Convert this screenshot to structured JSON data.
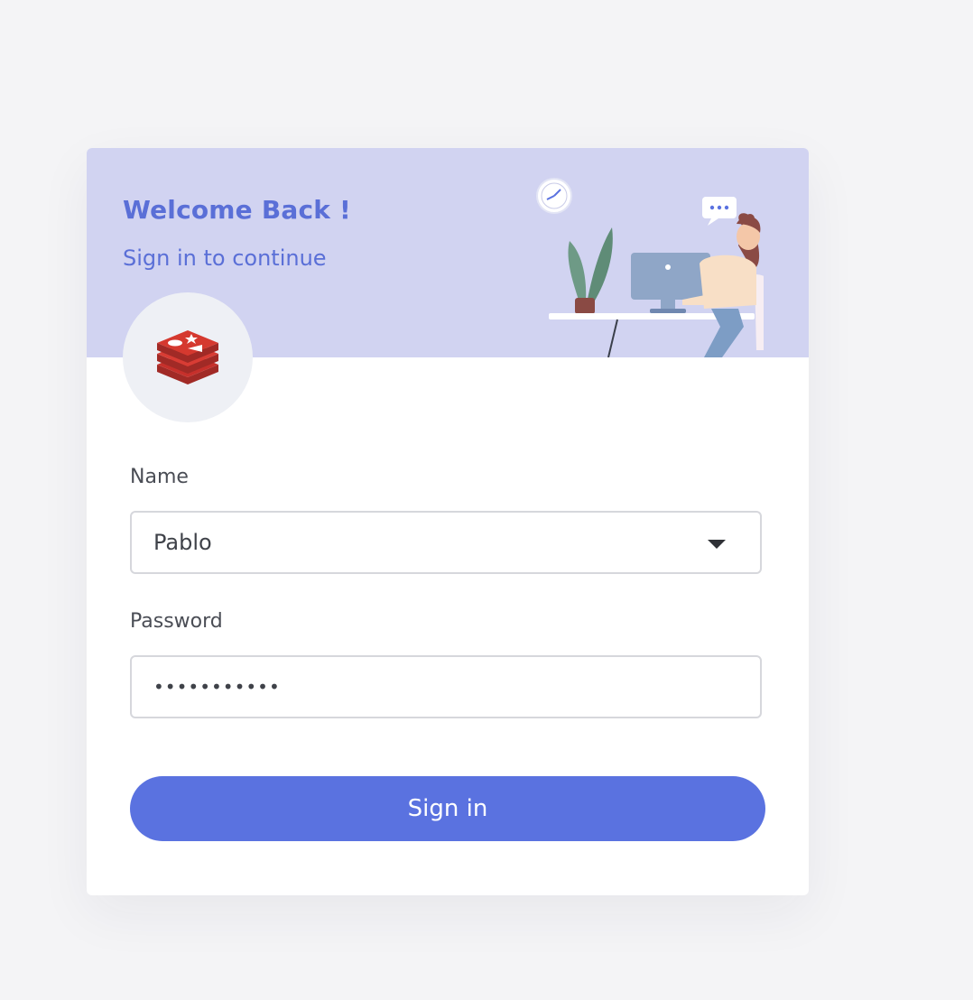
{
  "header": {
    "title": "Welcome Back !",
    "subtitle": "Sign in to continue"
  },
  "logo": {
    "icon": "redis-logo-icon"
  },
  "form": {
    "name_label": "Name",
    "name_value": "Pablo",
    "password_label": "Password",
    "password_value": "•••••••••••",
    "submit_label": "Sign in"
  },
  "colors": {
    "accent": "#5a72e0",
    "hero_bg": "#d1d3f1",
    "page_bg": "#f4f4f6",
    "logo_red": "#c6302b"
  }
}
